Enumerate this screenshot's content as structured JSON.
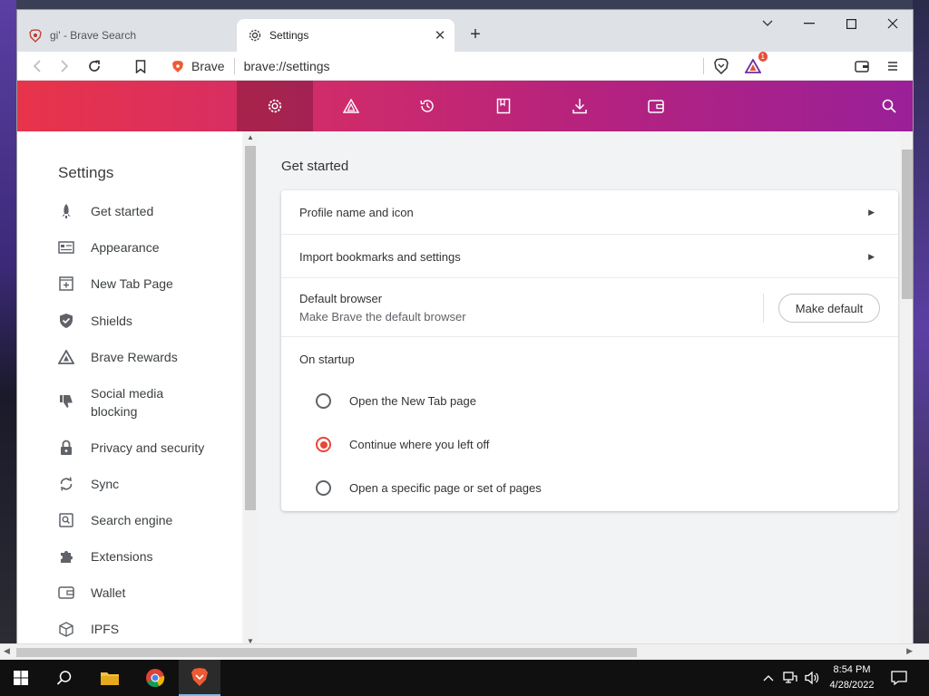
{
  "browser": {
    "tabs": [
      {
        "title": "gi' - Brave Search",
        "active": false
      },
      {
        "title": "Settings",
        "active": true
      }
    ],
    "omnibox": {
      "site_name": "Brave",
      "url": "brave://settings"
    },
    "rewards_badge": "1"
  },
  "settings_nav": {
    "icons": [
      "gear-icon",
      "rewards-triangle-icon",
      "history-icon",
      "bookmarks-icon",
      "download-icon",
      "wallet-icon"
    ],
    "selected": "gear-icon"
  },
  "sidebar": {
    "title": "Settings",
    "items": [
      {
        "label": "Get started",
        "icon": "rocket-icon"
      },
      {
        "label": "Appearance",
        "icon": "appearance-icon"
      },
      {
        "label": "New Tab Page",
        "icon": "new-tab-icon"
      },
      {
        "label": "Shields",
        "icon": "shield-icon"
      },
      {
        "label": "Brave Rewards",
        "icon": "rewards-icon"
      },
      {
        "label": "Social media blocking",
        "icon": "thumbs-down-icon"
      },
      {
        "label": "Privacy and security",
        "icon": "lock-icon"
      },
      {
        "label": "Sync",
        "icon": "sync-icon"
      },
      {
        "label": "Search engine",
        "icon": "search-engine-icon"
      },
      {
        "label": "Extensions",
        "icon": "puzzle-icon"
      },
      {
        "label": "Wallet",
        "icon": "wallet-icon"
      },
      {
        "label": "IPFS",
        "icon": "cube-icon"
      }
    ]
  },
  "main": {
    "section_title": "Get started",
    "profile_row": "Profile name and icon",
    "import_row": "Import bookmarks and settings",
    "default_browser": {
      "title": "Default browser",
      "subtitle": "Make Brave the default browser",
      "button": "Make default"
    },
    "on_startup": {
      "title": "On startup",
      "options": [
        {
          "label": "Open the New Tab page",
          "checked": false
        },
        {
          "label": "Continue where you left off",
          "checked": true
        },
        {
          "label": "Open a specific page or set of pages",
          "checked": false
        }
      ]
    }
  },
  "taskbar": {
    "time": "8:54 PM",
    "date": "4/28/2022"
  },
  "colors": {
    "header_gradient_start": "#e8344a",
    "header_gradient_end": "#9a2098",
    "radio_accent": "#e8473a"
  }
}
